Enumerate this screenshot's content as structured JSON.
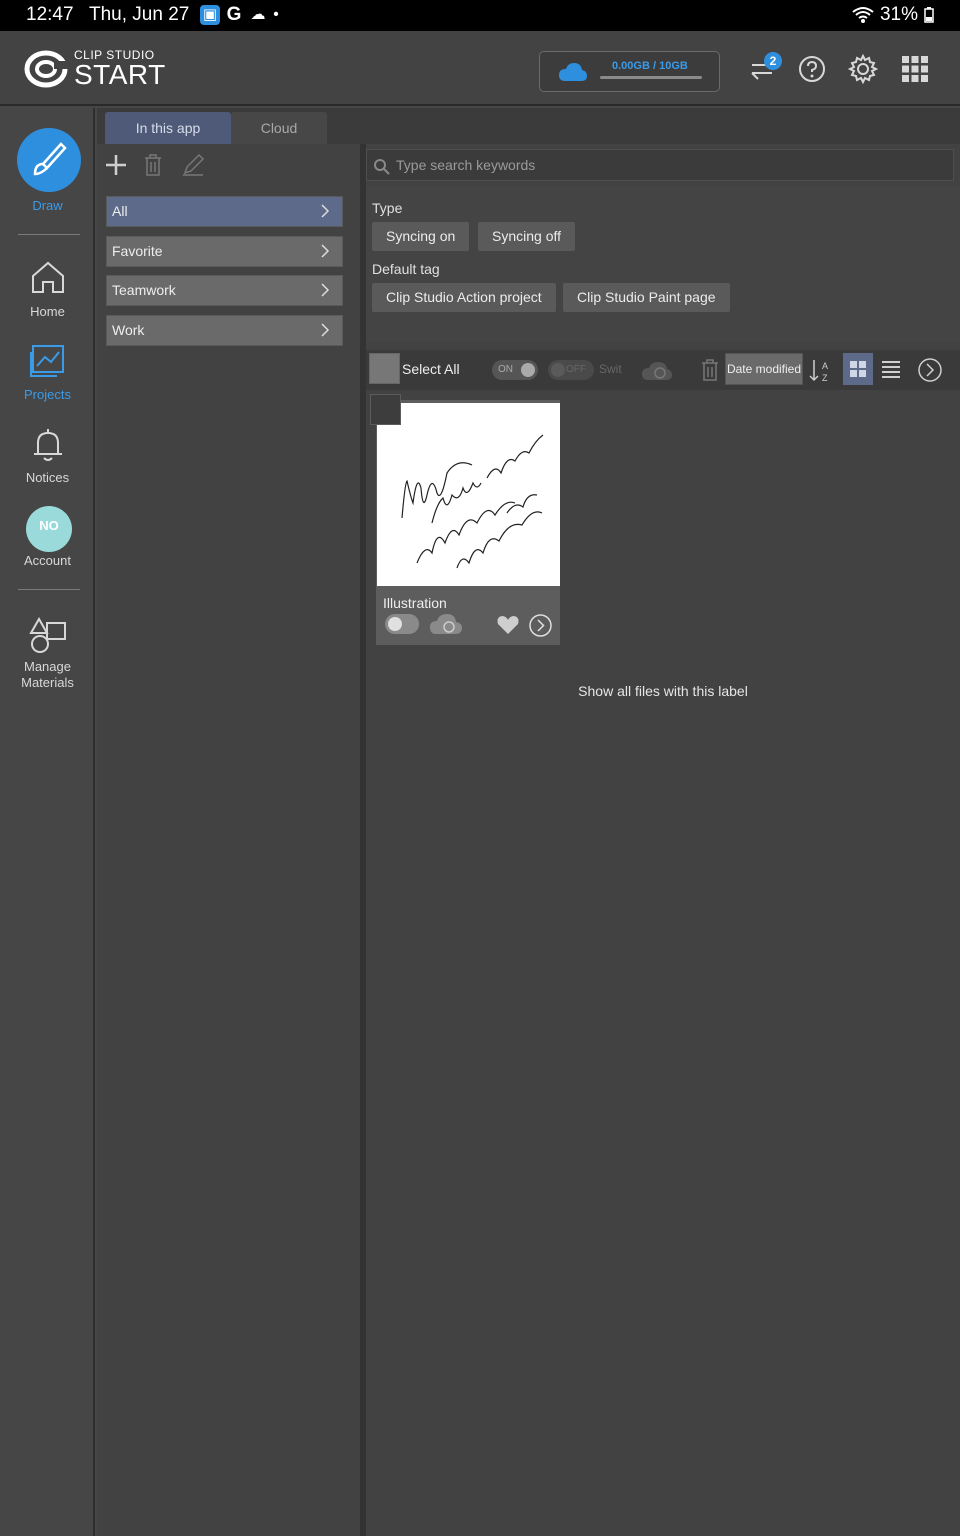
{
  "status": {
    "time": "12:47",
    "date": "Thu, Jun 27",
    "battery": "31%"
  },
  "header": {
    "logo_small": "CLIP STUDIO",
    "logo_big": "START",
    "storage": "0.00GB / 10GB",
    "badge": "2"
  },
  "sidebar": {
    "draw": "Draw",
    "home": "Home",
    "projects": "Projects",
    "notices": "Notices",
    "account": "Account",
    "avatar_text": "NO",
    "manage_materials_1": "Manage",
    "manage_materials_2": "Materials"
  },
  "tabs": {
    "in_app": "In this app",
    "cloud": "Cloud"
  },
  "left_list": [
    "All",
    "Favorite",
    "Teamwork",
    "Work"
  ],
  "search": {
    "placeholder": "Type search keywords"
  },
  "filters": {
    "type_label": "Type",
    "type_chips": [
      "Syncing on",
      "Syncing off"
    ],
    "tag_label": "Default tag",
    "tag_chips": [
      "Clip Studio Action project",
      "Clip Studio Paint page"
    ]
  },
  "toolbar": {
    "select_all": "Select All",
    "on": "ON",
    "off": "OFF",
    "switch": "Swit",
    "sort": "Date modified"
  },
  "files": [
    {
      "title": "Illustration"
    }
  ],
  "show_all": "Show all files with this label",
  "colors": {
    "accent": "#2f8fdf",
    "active_tab": "#4e5a77",
    "active_item": "#5d6a8a"
  }
}
